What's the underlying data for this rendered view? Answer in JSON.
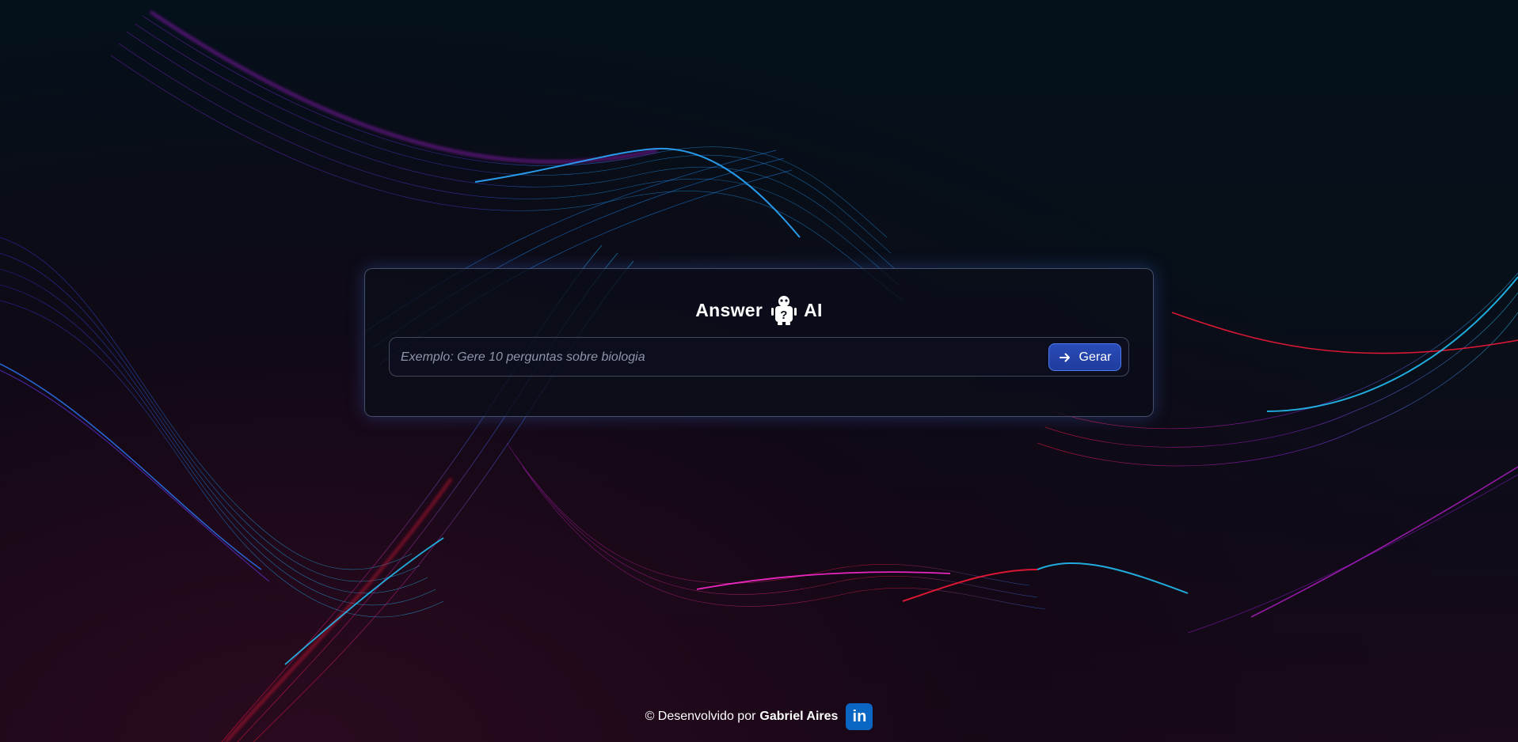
{
  "app": {
    "title_left": "Answer",
    "title_right": "AI",
    "logo_icon": "robot-question-icon"
  },
  "search": {
    "value": "",
    "placeholder": "Exemplo: Gere 10 perguntas sobre biologia"
  },
  "generate_button": {
    "label": "Gerar",
    "icon": "arrow-right-icon"
  },
  "footer": {
    "prefix": "© Desenvolvido por",
    "author": "Gabriel Aires",
    "social_icon": "linkedin-icon",
    "social_text": "in"
  },
  "colors": {
    "background": "#050d14",
    "button": "#1f3c9e",
    "button_border": "#4d7cf2",
    "linkedin": "#0a66c2",
    "wave_blue": "#1ea0ff",
    "wave_magenta": "#c21fd6",
    "wave_red": "#ff1a3a"
  }
}
